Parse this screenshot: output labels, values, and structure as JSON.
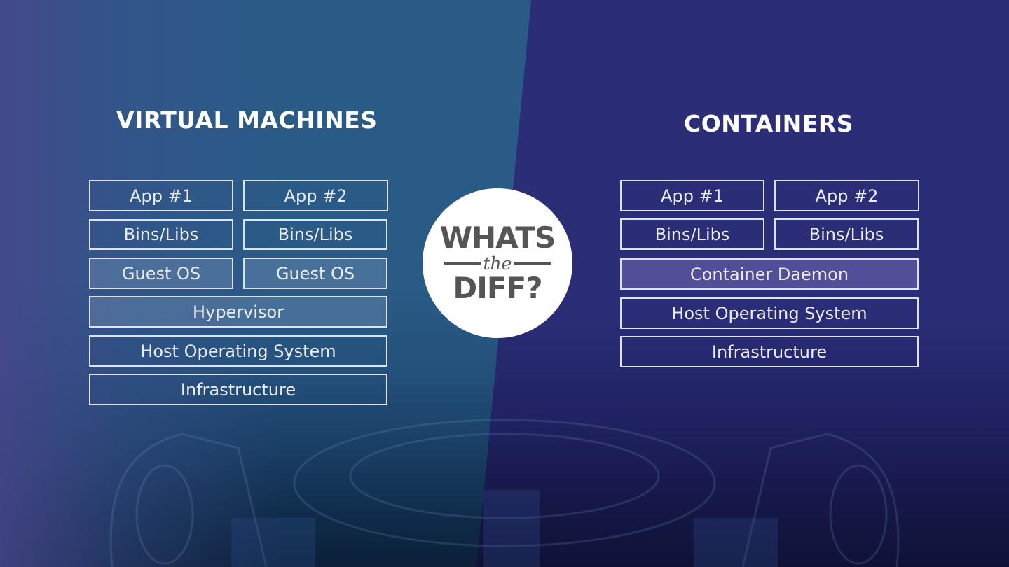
{
  "colors": {
    "left_panel": "#2a5b87",
    "right_panel": "#2b2d77",
    "box_border": "#dfe3ef",
    "text": "#ffffff",
    "badge_bg": "#ffffff",
    "badge_text": "#555555"
  },
  "left": {
    "title": "VIRTUAL MACHINES",
    "rows": [
      [
        "App #1",
        "App #2"
      ],
      [
        "Bins/Libs",
        "Bins/Libs"
      ],
      [
        "Guest OS",
        "Guest OS"
      ],
      [
        "Hypervisor"
      ],
      [
        "Host Operating System"
      ],
      [
        "Infrastructure"
      ]
    ]
  },
  "right": {
    "title": "CONTAINERS",
    "rows": [
      [
        "App #1",
        "App #2"
      ],
      [
        "Bins/Libs",
        "Bins/Libs"
      ],
      [
        "Container Daemon"
      ],
      [
        "Host Operating System"
      ],
      [
        "Infrastructure"
      ]
    ]
  },
  "badge": {
    "line1": "WHATS",
    "line2": "the",
    "line3": "DIFF?"
  },
  "background_image": "server-hardware-fan-icon"
}
